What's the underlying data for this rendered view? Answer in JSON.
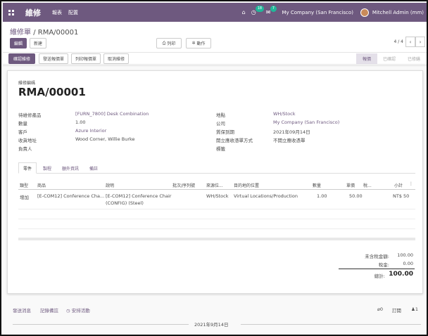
{
  "navbar": {
    "app_title": "維修",
    "menu": [
      "報表",
      "配置"
    ],
    "messages_count": "18",
    "activities_count": "7",
    "company": "My Company (San Francisco)",
    "user": "Mitchell Admin (mm)"
  },
  "breadcrumb": {
    "parent": "維修單",
    "separator": "/",
    "current": "RMA/00001"
  },
  "toolbar": {
    "edit_label": "編輯",
    "create_label": "新建",
    "print_label": "列印",
    "action_label": "動作",
    "pager": "4 / 4"
  },
  "workflow": {
    "buttons": [
      "確認維修",
      "發送報價單",
      "列印報價單",
      "取消維修"
    ],
    "stages": [
      "報價",
      "已確認",
      "已修繕"
    ]
  },
  "form": {
    "ref_label": "維修編碼",
    "ref": "RMA/00001",
    "left": [
      {
        "label": "待維修產品",
        "value": "[FURN_7800] Desk Combination"
      },
      {
        "label": "數量",
        "value": "1.00"
      },
      {
        "label": "客戶",
        "value": "Azure Interior"
      },
      {
        "label": "收貨地址",
        "value": "Wood Corner, Willie Burke"
      },
      {
        "label": "負責人",
        "value": ""
      }
    ],
    "right": [
      {
        "label": "地點",
        "value": "WH/Stock"
      },
      {
        "label": "公司",
        "value": "My Company (San Francisco)"
      },
      {
        "label": "質保到期",
        "value": "2021年09月14日"
      },
      {
        "label": "開立應收憑單方式",
        "value": "不開立應收憑單"
      },
      {
        "label": "標籤",
        "value": ""
      }
    ]
  },
  "tabs": [
    "零件",
    "製程",
    "額外資訊",
    "備註"
  ],
  "lines": {
    "headers": [
      "類型",
      "商品",
      "說明",
      "批次/序列號",
      "來源位...",
      "目的地的位置",
      "數量",
      "單價",
      "稅...",
      "小計"
    ],
    "rows": [
      {
        "type": "增加",
        "product": "[E-COM12] Conference Cha...",
        "desc_line1": "[E-COM12] Conference Chair",
        "desc_line2": "(CONFIG) (Steel)",
        "lot": "",
        "source": "WH/Stock",
        "dest": "Virtual Locations/Production",
        "qty": "1.00",
        "price": "50.00",
        "tax": "",
        "subtotal": "NT$ 50"
      }
    ]
  },
  "totals": {
    "untaxed_label": "未含稅金額:",
    "untaxed": "100.00",
    "tax_label": "稅金:",
    "tax": "0.00",
    "total_label": "總計:",
    "total": "100.00"
  },
  "chatter": {
    "send_message": "發送消息",
    "log_note": "記錄備註",
    "schedule": "安排活動",
    "attachments": "0",
    "follow": "訂閱",
    "followers": "1",
    "date": "2021年9月14日"
  },
  "colors": {
    "brand": "#6e597f",
    "badge": "#21b799"
  }
}
